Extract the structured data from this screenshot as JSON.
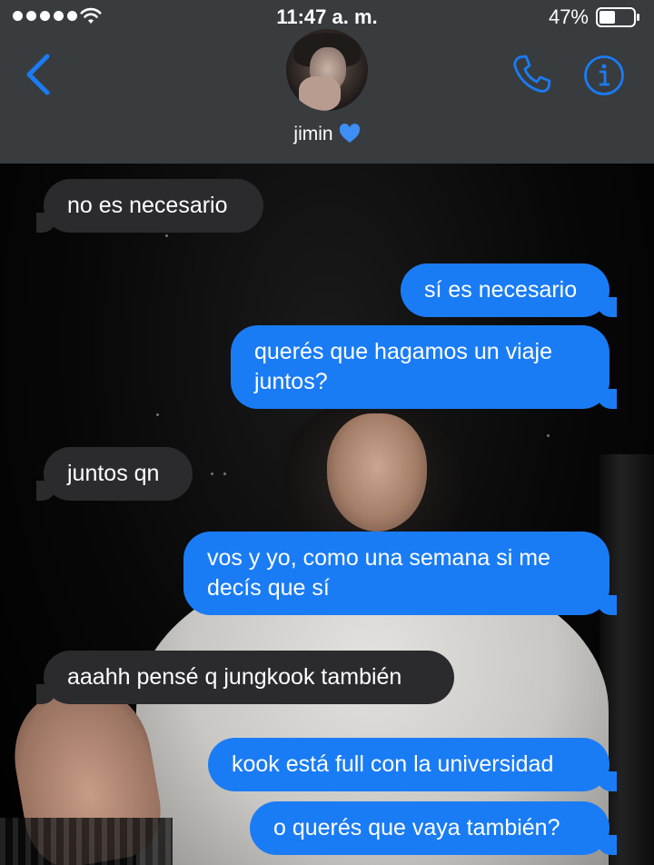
{
  "status_bar": {
    "time": "11:47 a. m.",
    "battery_percent": "47%",
    "signal_bars": 5,
    "battery_level": 0.47
  },
  "header": {
    "contact_name": "jimin",
    "name_emoji_icon": "blue-heart-icon",
    "back_icon": "chevron-left-icon",
    "call_icon": "phone-icon",
    "info_icon": "info-icon"
  },
  "messages": [
    {
      "sender": "them",
      "text": "no es necesario"
    },
    {
      "sender": "me",
      "text": "sí es necesario"
    },
    {
      "sender": "me",
      "text": "querés que hagamos un viaje juntos?"
    },
    {
      "sender": "them",
      "text": "juntos qn"
    },
    {
      "sender": "me",
      "text": "vos y yo, como una semana si me decís que sí"
    },
    {
      "sender": "them",
      "text": "aaahh pensé q jungkook también"
    },
    {
      "sender": "me",
      "text": "kook está full con la universidad"
    },
    {
      "sender": "me",
      "text": "o querés que vaya también?"
    }
  ],
  "colors": {
    "accent": "#1a7cf5",
    "received_bubble": "#2b2b2d",
    "header_bg": "#3a3e42",
    "heart": "#3d8ef5"
  }
}
